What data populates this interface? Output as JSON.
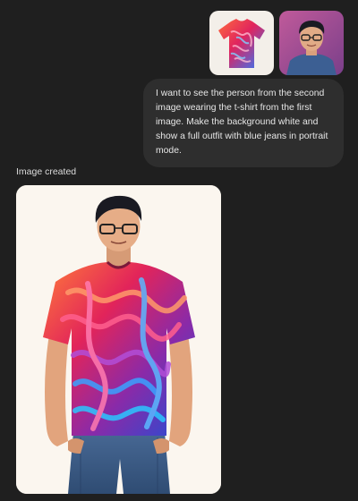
{
  "conversation": {
    "user_message": {
      "attachments": [
        {
          "name": "tshirt-image",
          "icon": "tshirt-thumbnail"
        },
        {
          "name": "person-image",
          "icon": "person-portrait-thumbnail"
        }
      ],
      "text": "I want to see the person from the second image wearing the t-shirt from the first image. Make the background white and show a full outfit with blue jeans in portrait mode."
    },
    "assistant_response": {
      "status_label": "Image created",
      "image": {
        "name": "generated-outfit-image"
      }
    }
  },
  "colors": {
    "background": "#1f1f1f",
    "bubble": "#2e2e2e",
    "image_bg": "#fbf6ef",
    "jeans": "#3f5f86"
  }
}
